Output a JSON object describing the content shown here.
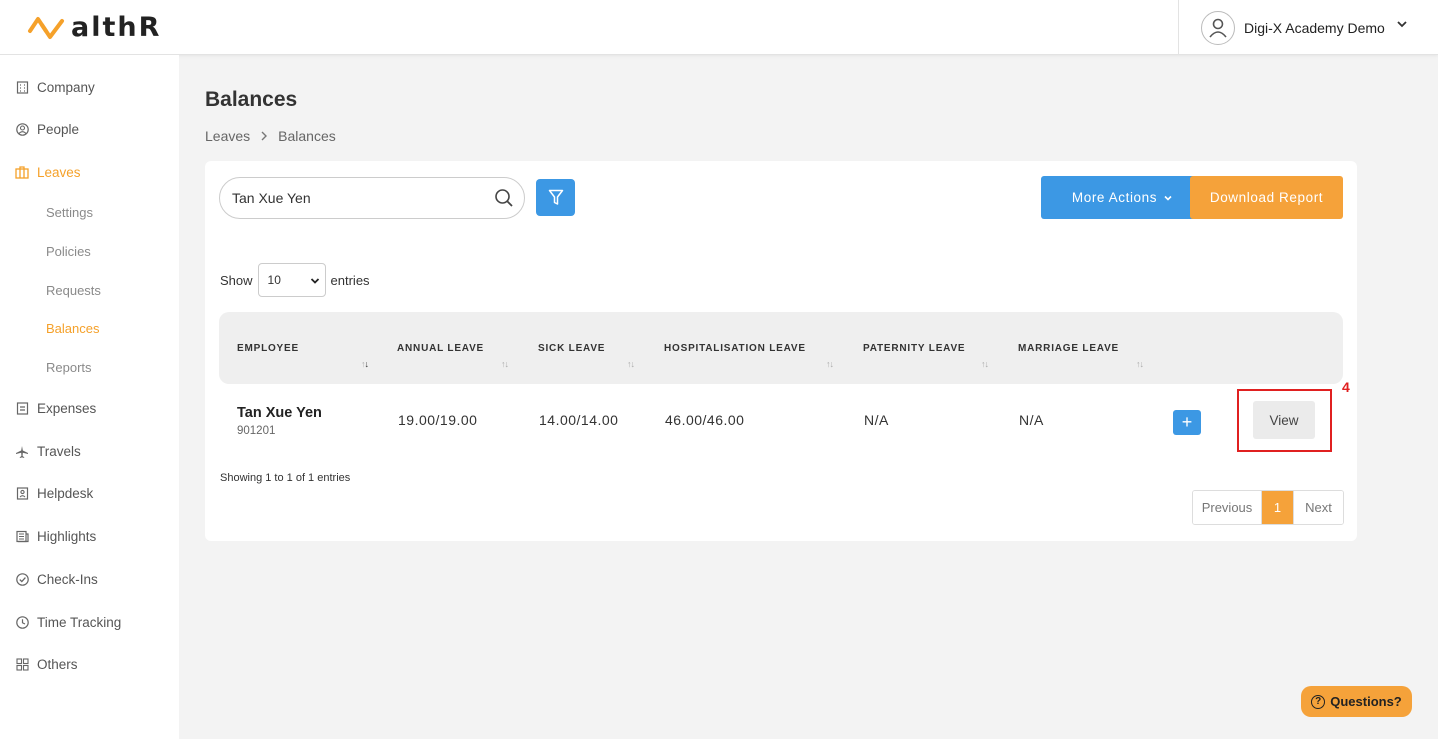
{
  "app": {
    "logo_text": "althR"
  },
  "header": {
    "user_name": "Digi-X Academy Demo"
  },
  "sidebar": {
    "items": [
      {
        "label": "Company",
        "icon": "building-icon"
      },
      {
        "label": "People",
        "icon": "user-circle-icon"
      },
      {
        "label": "Leaves",
        "icon": "suitcase-icon",
        "active": true
      },
      {
        "label": "Expenses",
        "icon": "receipt-icon"
      },
      {
        "label": "Travels",
        "icon": "plane-icon"
      },
      {
        "label": "Helpdesk",
        "icon": "helpdesk-icon"
      },
      {
        "label": "Highlights",
        "icon": "newspaper-icon"
      },
      {
        "label": "Check-Ins",
        "icon": "check-circle-icon"
      },
      {
        "label": "Time Tracking",
        "icon": "clock-icon"
      },
      {
        "label": "Others",
        "icon": "grid-icon"
      }
    ],
    "leaves_sub": [
      "Settings",
      "Policies",
      "Requests",
      "Balances",
      "Reports"
    ]
  },
  "page": {
    "title": "Balances",
    "breadcrumb": [
      "Leaves",
      "Balances"
    ]
  },
  "toolbar": {
    "search_value": "Tan Xue Yen",
    "more_actions_label": "More Actions",
    "download_label": "Download Report"
  },
  "entries": {
    "show_label": "Show",
    "value": "10",
    "suffix": "entries"
  },
  "table": {
    "headers": [
      "EMPLOYEE",
      "ANNUAL LEAVE",
      "SICK LEAVE",
      "HOSPITALISATION LEAVE",
      "PATERNITY LEAVE",
      "MARRIAGE LEAVE"
    ],
    "rows": [
      {
        "name": "Tan Xue Yen",
        "id": "901201",
        "annual": "19.00/19.00",
        "sick": "14.00/14.00",
        "hospitalisation": "46.00/46.00",
        "paternity": "N/A",
        "marriage": "N/A",
        "add_label": "+",
        "view_label": "View"
      }
    ],
    "annotation_label": "4"
  },
  "footer": {
    "showing_text": "Showing 1 to 1 of 1 entries",
    "prev_label": "Previous",
    "current_page": "1",
    "next_label": "Next"
  },
  "help": {
    "label": "Questions?",
    "icon_glyph": "?"
  },
  "colors": {
    "accent_orange": "#f5a23a",
    "accent_blue": "#3c98e4",
    "annotation_red": "#e02020"
  }
}
